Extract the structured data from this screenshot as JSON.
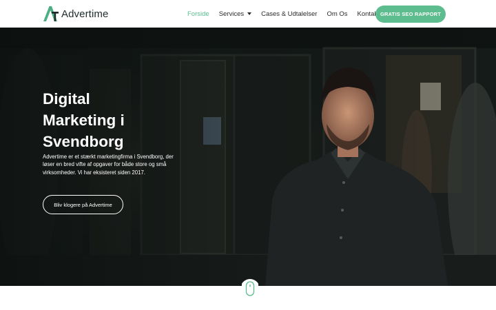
{
  "header": {
    "logo_text": "Advertime",
    "nav": [
      {
        "label": "Forside",
        "active": true
      },
      {
        "label": "Services",
        "dropdown": true
      },
      {
        "label": "Cases & Udtalelser"
      },
      {
        "label": "Om Os"
      },
      {
        "label": "Kontakt"
      }
    ],
    "cta_label": "GRATIS SEO RAPPORT"
  },
  "hero": {
    "title_lines": [
      "Digital",
      "Marketing i",
      "Svendborg"
    ],
    "description": "Advertime er et stærkt marketingfirma i Svendborg, der løser en bred vifte af opgaver for både store og små virksomheder. Vi har eksisteret siden 2017.",
    "button_label": "Bliv klogere på Advertime"
  },
  "colors": {
    "accent": "#5dbd8e",
    "active_nav": "#5bbd8f",
    "text_dark": "#2b2b2b",
    "hero_bg": "#141a18"
  },
  "icons": [
    "advertime-logo-icon",
    "chevron-down-icon",
    "scroll-mouse-icon"
  ]
}
